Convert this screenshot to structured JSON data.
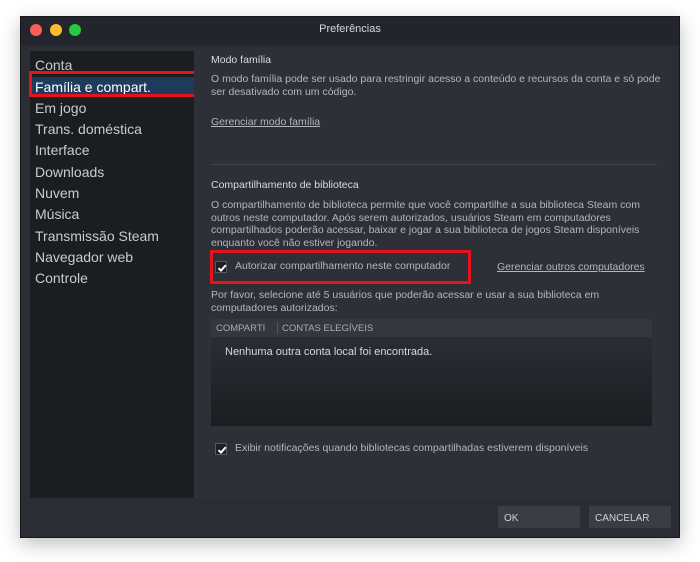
{
  "window": {
    "title": "Preferências"
  },
  "sidebar": {
    "items": [
      {
        "label": "Conta"
      },
      {
        "label": "Família e compart.",
        "active": true
      },
      {
        "label": "Em jogo"
      },
      {
        "label": "Trans. doméstica"
      },
      {
        "label": "Interface"
      },
      {
        "label": "Downloads"
      },
      {
        "label": "Nuvem"
      },
      {
        "label": "Música"
      },
      {
        "label": "Transmissão Steam"
      },
      {
        "label": "Navegador web"
      },
      {
        "label": "Controle"
      }
    ]
  },
  "family_mode": {
    "title": "Modo família",
    "description": "O modo família pode ser usado para restringir acesso a conteúdo e recursos da conta e só pode ser desativado com um código.",
    "manage_link": "Gerenciar modo família"
  },
  "library_sharing": {
    "title": "Compartilhamento de biblioteca",
    "description": "O compartilhamento de biblioteca permite que você compartilhe a sua biblioteca Steam com outros neste computador. Após serem autorizados, usuários Steam em computadores compartilhados poderão acessar, baixar e jogar a sua biblioteca de jogos Steam disponíveis enquanto você não estiver jogando.",
    "authorize_checkbox": {
      "label": "Autorizar compartilhamento neste computador",
      "checked": true
    },
    "manage_other_link": "Gerenciar outros computadores",
    "select_users_text": "Por favor, selecione até 5 usuários que poderão acessar e usar a sua biblioteca em computadores autorizados:",
    "table": {
      "columns": [
        "COMPARTI",
        "CONTAS ELEGÍVEIS"
      ],
      "empty_message": "Nenhuma outra conta local foi encontrada."
    },
    "notify_checkbox": {
      "label": "Exibir notificações quando bibliotecas compartilhadas estiverem disponíveis",
      "checked": true
    }
  },
  "buttons": {
    "ok": "OK",
    "cancel": "CANCELAR"
  },
  "colors": {
    "highlight": "#e8121c",
    "active_nav": "#1e3b5c",
    "background": "#2a2d33"
  }
}
